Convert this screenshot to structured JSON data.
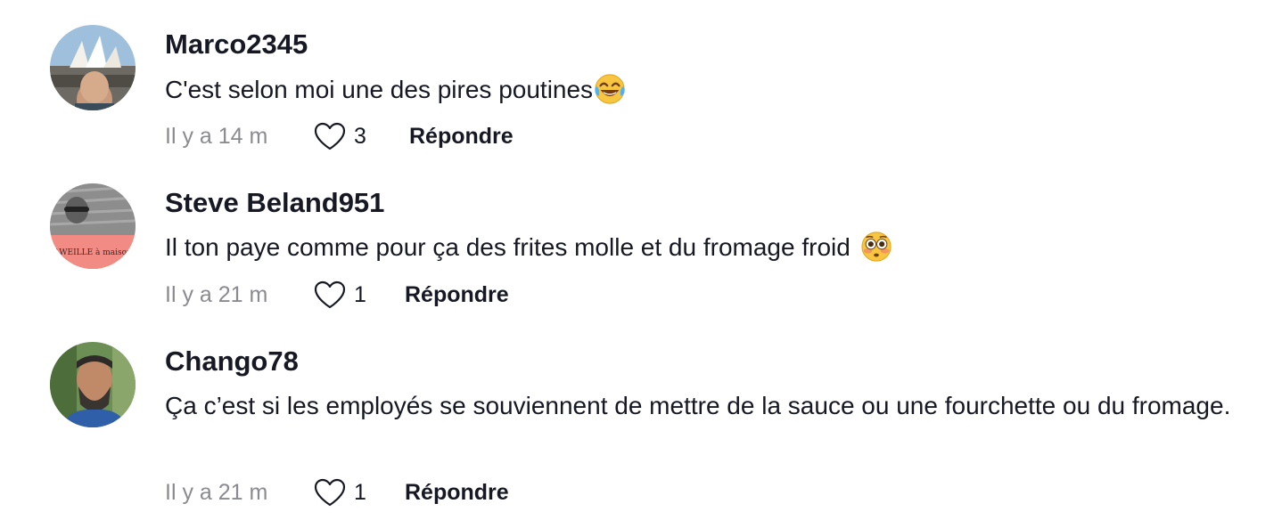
{
  "comments": [
    {
      "username": "Marco2345",
      "text": "C'est selon moi une des pires poutines",
      "emoji_icon": "face-with-tears-of-joy-icon",
      "time": "Il y a 14 m",
      "likes": "3",
      "reply_label": "Répondre",
      "avatar_desc_icon": "user-avatar-icon"
    },
    {
      "username": "Steve Beland951",
      "text": "Il ton paye comme pour ça des frites molle et du fromage froid ",
      "emoji_icon": "flushed-face-icon",
      "time": "Il y a 21 m",
      "likes": "1",
      "reply_label": "Répondre",
      "avatar_text": "AWEILLE à maison"
    },
    {
      "username": "Chango78",
      "text": "Ça c’est si les employés se souviennent de mettre de la sauce ou une fourchette ou du fromage.",
      "time": "Il y a 21 m",
      "likes": "1",
      "reply_label": "Répondre"
    }
  ],
  "colors": {
    "primary_text": "#161823",
    "secondary_text": "#8a8b91",
    "heart_outline": "#161823"
  },
  "icons": {
    "like": "heart-outline-icon"
  }
}
